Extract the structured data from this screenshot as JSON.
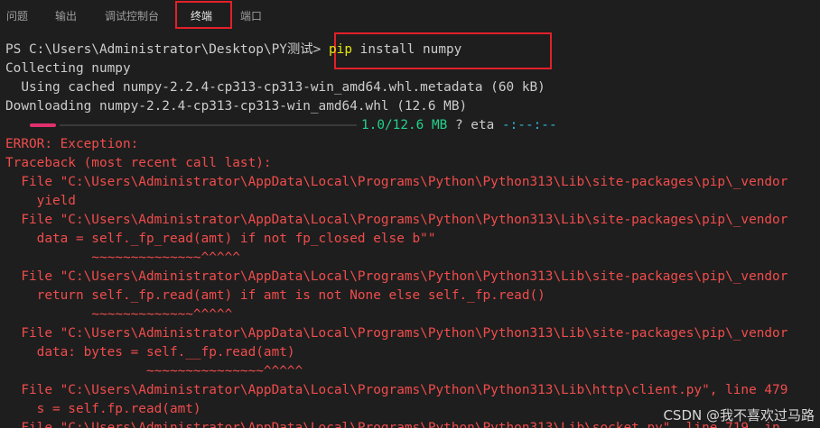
{
  "tabs": [
    {
      "label": "问题"
    },
    {
      "label": "输出"
    },
    {
      "label": "调试控制台"
    },
    {
      "label": "终端"
    },
    {
      "label": "端口"
    }
  ],
  "terminal": {
    "prompt": "PS C:\\Users\\Administrator\\Desktop\\PY测试> ",
    "command": "pip",
    "command_args": " install numpy",
    "collecting": "Collecting numpy",
    "using_cached": "  Using cached numpy-2.2.4-cp313-cp313-win_amd64.whl.metadata (60 kB)",
    "downloading": "Downloading numpy-2.2.4-cp313-cp313-win_amd64.whl (12.6 MB)",
    "progress_text": "1.0/12.6 MB",
    "progress_fraction": 0.08,
    "progress_eta": " ? eta ",
    "progress_eta_value": "-:--:--",
    "error_lines": [
      "ERROR: Exception:",
      "Traceback (most recent call last):",
      "  File \"C:\\Users\\Administrator\\AppData\\Local\\Programs\\Python\\Python313\\Lib\\site-packages\\pip\\_vendor",
      "    yield",
      "  File \"C:\\Users\\Administrator\\AppData\\Local\\Programs\\Python\\Python313\\Lib\\site-packages\\pip\\_vendor",
      "    data = self._fp_read(amt) if not fp_closed else b\"\"",
      "           ~~~~~~~~~~~~~~^^^^^",
      "  File \"C:\\Users\\Administrator\\AppData\\Local\\Programs\\Python\\Python313\\Lib\\site-packages\\pip\\_vendor",
      "    return self._fp.read(amt) if amt is not None else self._fp.read()",
      "           ~~~~~~~~~~~~~^^^^^",
      "  File \"C:\\Users\\Administrator\\AppData\\Local\\Programs\\Python\\Python313\\Lib\\site-packages\\pip\\_vendor",
      "    data: bytes = self.__fp.read(amt)",
      "                  ~~~~~~~~~~~~~~~^^^^^",
      "  File \"C:\\Users\\Administrator\\AppData\\Local\\Programs\\Python\\Python313\\Lib\\http\\client.py\", line 479",
      "    s = self.fp.read(amt)",
      "  File \"C:\\Users\\Administrator\\AppData\\Local\\Programs\\Python\\Python313\\Lib\\socket.py\", line 719, in"
    ]
  },
  "watermark": "CSDN @我不喜欢过马路",
  "colors": {
    "background": "#1e1e1e",
    "error": "#f14c4c",
    "command": "#e5e510",
    "progress_text": "#23d18b",
    "progress_bar": "#e0306e",
    "highlight_box": "#e3202a"
  }
}
